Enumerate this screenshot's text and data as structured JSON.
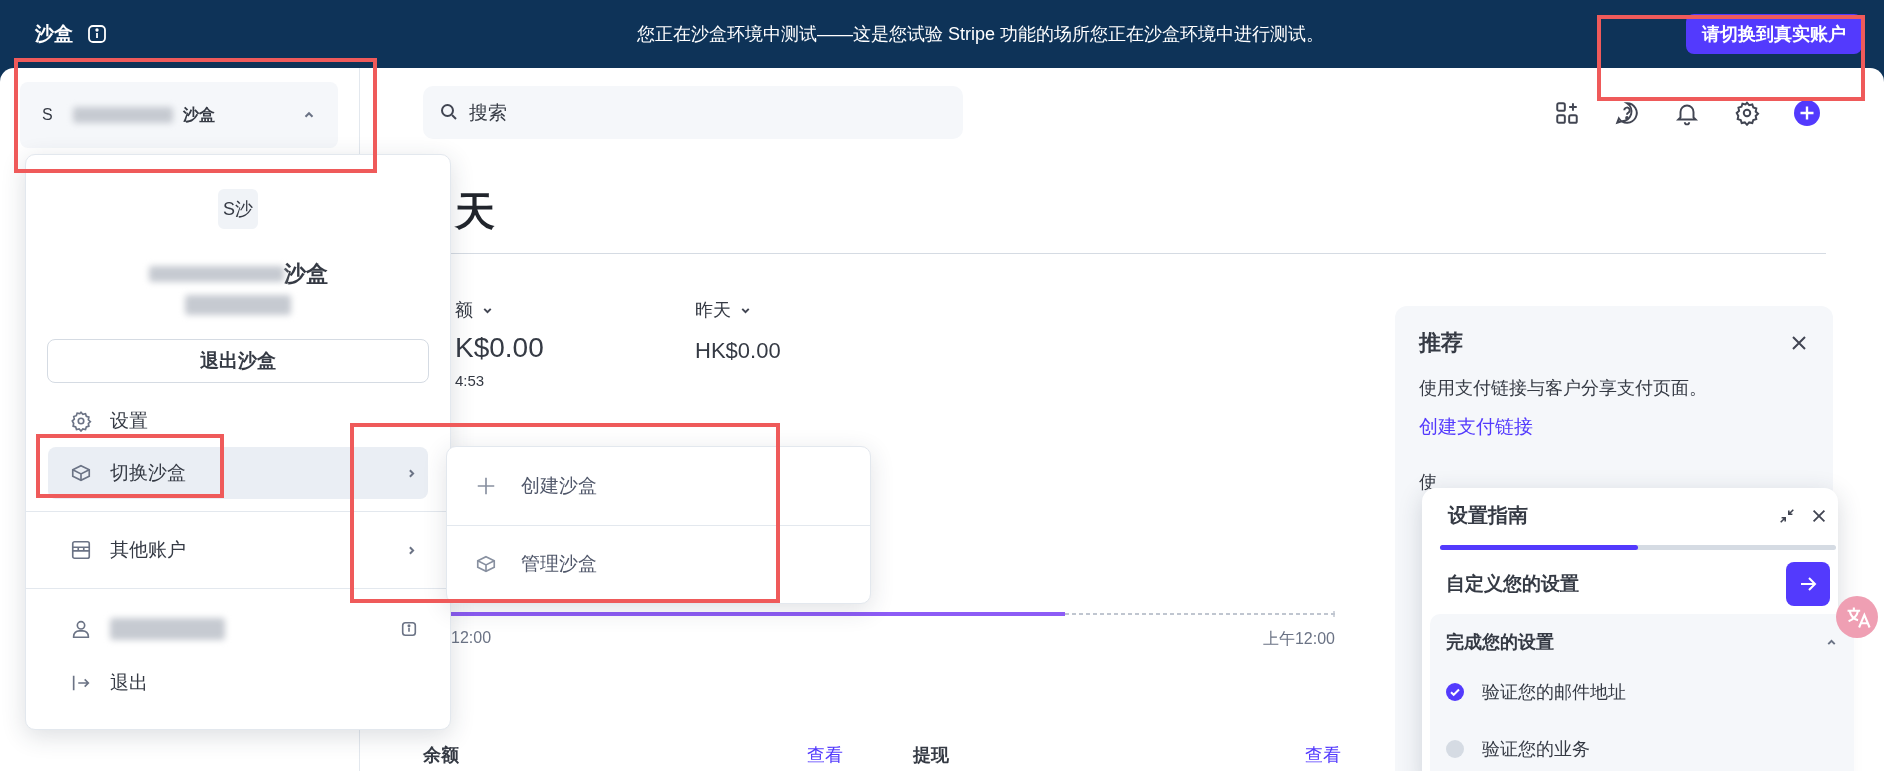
{
  "banner": {
    "label": "沙盒",
    "message": "您正在沙盒环境中测试——这是您试验 Stripe 功能的场所您正在沙盒环境中进行测试。",
    "button": "请切换到真实账户"
  },
  "account_switcher": {
    "initial": "S",
    "name_suffix": "沙盒",
    "expanded": true
  },
  "account_menu": {
    "avatar": "S沙",
    "name_suffix": "沙盒",
    "exit_button": "退出沙盒",
    "items": [
      {
        "kind": "settings",
        "label": "设置",
        "selected": false,
        "has_submenu": false
      },
      {
        "kind": "sandbox",
        "label": "切换沙盒",
        "selected": true,
        "has_submenu": true
      },
      {
        "kind": "store",
        "label": "其他账户",
        "selected": false,
        "has_submenu": true
      }
    ],
    "logout": "退出"
  },
  "submenu": {
    "items": [
      {
        "kind": "create",
        "label": "创建沙盒"
      },
      {
        "kind": "sandbox",
        "label": "管理沙盒"
      }
    ]
  },
  "search": {
    "placeholder": "搜索"
  },
  "page_title": "天",
  "stats": [
    {
      "label": "额",
      "value": "K$0.00",
      "time": "4:53",
      "large": true
    },
    {
      "label": "昨天",
      "value": "HK$0.00",
      "large": false
    }
  ],
  "chart_labels": {
    "start": "12:00",
    "end": "上午12:00"
  },
  "bottom": [
    {
      "label": "余额",
      "link": "查看"
    },
    {
      "label": "提现",
      "link": "查看"
    }
  ],
  "recommend": {
    "title": "推荐",
    "text": "使用支付链接与客户分享支付页面。",
    "link": "创建支付链接",
    "text_2": "使"
  },
  "setup_guide": {
    "title": "设置指南",
    "level": 0.5,
    "next_step": "自定义您的设置",
    "section": {
      "title": "完成您的设置",
      "expanded": true,
      "tasks": [
        {
          "label": "验证您的邮件地址",
          "checked": true
        },
        {
          "label": "验证您的业务",
          "checked": false
        }
      ]
    }
  }
}
